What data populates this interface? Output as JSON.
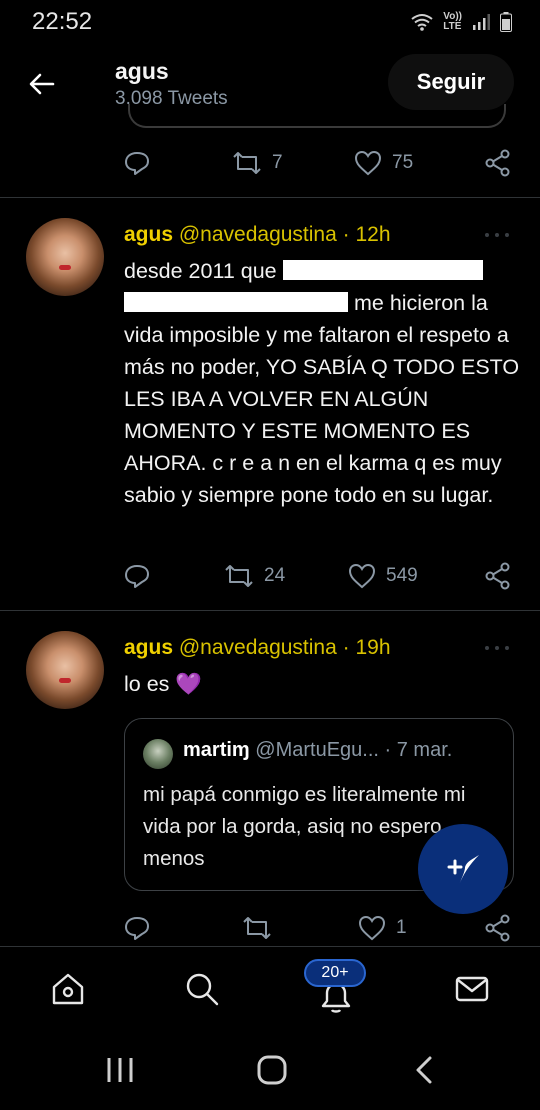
{
  "status": {
    "time": "22:52",
    "volte_top": "Vo))",
    "volte_bottom": "LTE"
  },
  "header": {
    "name": "agus",
    "tweet_count": "3.098 Tweets",
    "follow_label": "Seguir",
    "back_icon": "arrow-left-icon"
  },
  "prev_tweet_actions": {
    "retweets": "7",
    "likes": "75"
  },
  "tweets": [
    {
      "name": "agus",
      "handle": "@navedagustina",
      "sep": " · ",
      "time": "12h",
      "text_1": "desde 2011 que",
      "text_2": "me hicieron la vida imposible y me faltaron el respeto a más no poder, YO SABÍA Q TODO ESTO LES IBA A VOLVER EN ALGÚN MOMENTO Y ESTE MOMENTO ES AHORA. c r e a n  en el karma q es muy sabio y siempre pone todo en su lugar.",
      "retweets": "24",
      "likes": "549"
    },
    {
      "name": "agus",
      "handle": "@navedagustina",
      "sep": " · ",
      "time": "19h",
      "text": "lo es 💜",
      "quote": {
        "name": "martiɱ",
        "handle": "@MartuEgu...",
        "time": " · 7 mar.",
        "text": "mi papá conmigo es literalmente mi vida por la gorda, asiq no espero menos"
      },
      "retweets": "",
      "likes": "1"
    }
  ],
  "bottom_nav": {
    "notification_badge": "20+",
    "items": [
      "home-icon",
      "search-icon",
      "bell-icon",
      "mail-icon"
    ]
  },
  "colors": {
    "accent_name": "#f0d000",
    "fab": "#0a2f7a",
    "muted": "#8b98a5"
  }
}
